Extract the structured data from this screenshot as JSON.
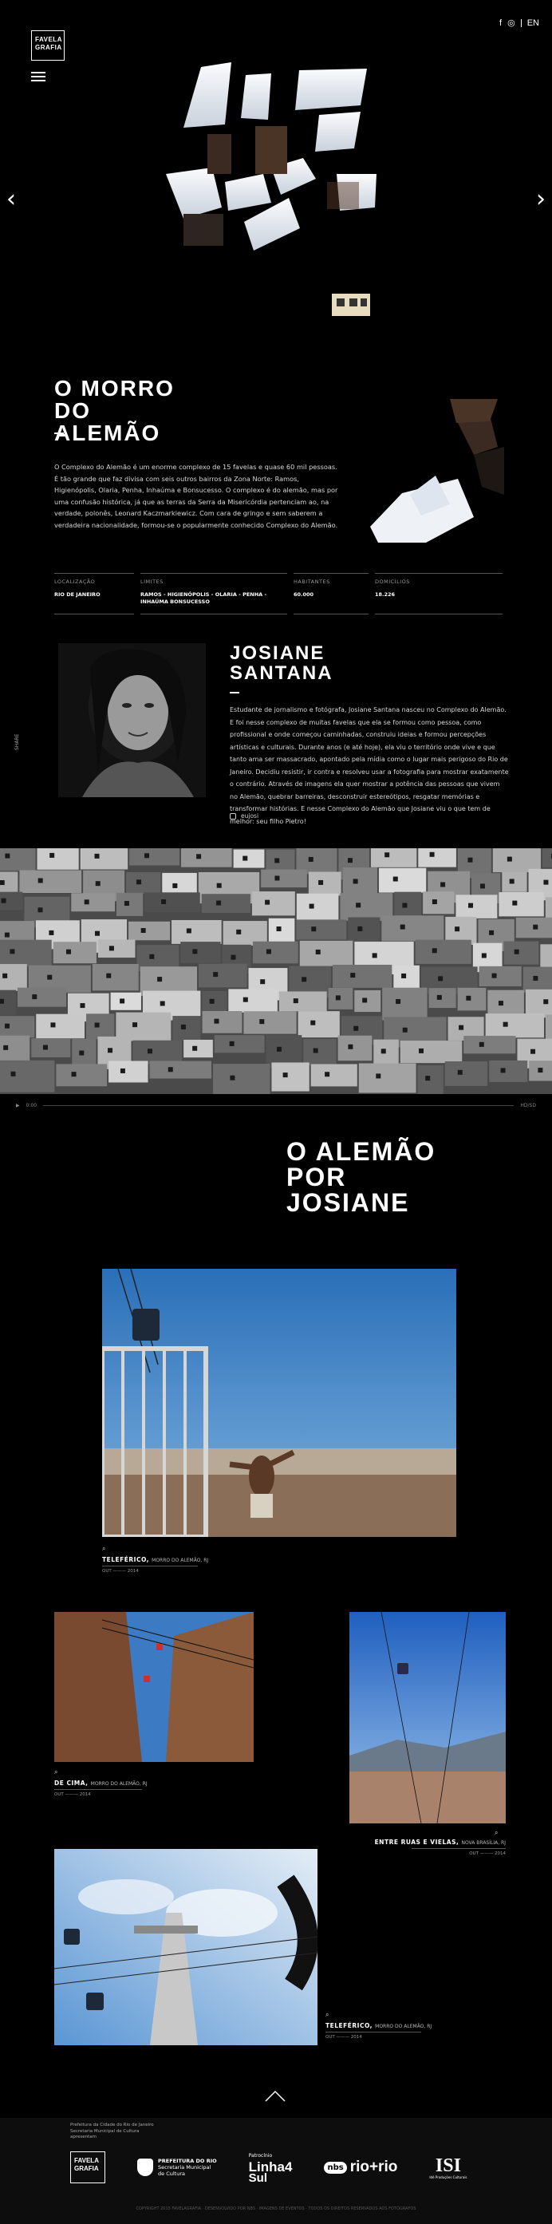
{
  "header": {
    "logo_line1": "FAVELA",
    "logo_line2": "GRAFIA",
    "social": [
      "f",
      "◎"
    ],
    "language": "EN"
  },
  "hero": {
    "prev": "‹",
    "next": "›"
  },
  "morro": {
    "title_line1": "O MORRO",
    "title_line2": "DO",
    "title_line3": "ALEMÃO",
    "text": "O Complexo do Alemão é um enorme complexo de 15 favelas e quase 60 mil pessoas. É tão grande que faz divisa com seis outros bairros da Zona Norte: Ramos, Higienópolis, Olaria, Penha, Inhaúma e Bonsucesso. O complexo é do alemão, mas por uma confusão histórica, já que as terras da Serra da Misericórdia pertenciam ao, na verdade, polonês, Leonard Kaczmarkiewicz. Com cara de gringo e sem saberem a verdadeira nacionalidade, formou-se o popularmente conhecido Complexo do Alemão.",
    "facts": [
      {
        "label": "LOCALIZAÇÃO",
        "value": "RIO DE JANEIRO"
      },
      {
        "label": "LIMITES",
        "value": "RAMOS - HIGIENÓPOLIS - OLARIA - PENHA - INHAÚMA BONSUCESSO"
      },
      {
        "label": "HABITANTES",
        "value": "60.000"
      },
      {
        "label": "DOMICÍLIOS",
        "value": "18.226"
      }
    ]
  },
  "photographer": {
    "name_line1": "JOSIANE",
    "name_line2": "SANTANA",
    "bio": "Estudante de jornalismo e fotógrafa, Josiane Santana nasceu no Complexo do Alemão. E foi nesse complexo de muitas favelas que ela se formou como pessoa, como profissional e onde começou caminhadas, construiu ideias e formou percepções artísticas e culturais. Durante anos (e até hoje), ela viu o território onde vive e que tanto ama ser massacrado, apontado pela mídia como o lugar mais perigoso do Rio de Janeiro. Decidiu resistir, ir contra e resolveu usar a fotografia para mostrar exatamente o contrário. Através de imagens ela quer mostrar a potência das pessoas que vivem no Alemão, quebrar barreiras, desconstruir estereótipos, resgatar memórias e transformar histórias. E nesse Complexo do Alemão que Josiane viu o que tem de melhor: seu filho Pietro!",
    "instagram": "eujosi",
    "share_label": "SHARE"
  },
  "video": {
    "time": "0:00",
    "quality": "HD/SD"
  },
  "gallery": {
    "title_line1": "O ALEMÃO",
    "title_line2": "POR",
    "title_line3": "JOSIANE",
    "photos": [
      {
        "title": "TELEFÉRICO,",
        "place": "MORRO DO ALEMÃO, RJ",
        "date": "OUT ——— 2014"
      },
      {
        "title": "DE CIMA,",
        "place": "MORRO DO ALEMÃO, RJ",
        "date": "OUT ——— 2014"
      },
      {
        "title": "ENTRE RUAS E VIELAS,",
        "place": "NOVA BRASÍLIA, RJ",
        "date": "OUT ——— 2014"
      },
      {
        "title": "TELEFÉRICO,",
        "place": "MORRO DO ALEMÃO, RJ",
        "date": "OUT ——— 2014"
      }
    ]
  },
  "footer": {
    "credit_line1": "Prefeitura da Cidade do Rio de Janeiro",
    "credit_line2": "Secretaria Municipal de Cultura",
    "credit_line3": "apresentam",
    "logo_line1": "FAVELA",
    "logo_line2": "GRAFIA",
    "sponsor1_line1": "PREFEITURA DO RIO",
    "sponsor1_line2": "Secretaria Municipal",
    "sponsor1_line3": "de Cultura",
    "sponsor2_small": "Patrocínio",
    "sponsor2": "Linha4",
    "sponsor2_b": "Sul",
    "sponsor3": "nbs",
    "sponsor3_b": "rio+rio",
    "sponsor4": "ISI",
    "sponsor4_small": "Idé Produções Culturais",
    "copyright": "COPYRIGHT 2015 FAVELAGRAFIA · DESENVOLVIDO POR NBS · IMAGENS DE EVENTOS · TODOS OS DIREITOS RESERVADOS AOS FOTÓGRAFOS"
  }
}
